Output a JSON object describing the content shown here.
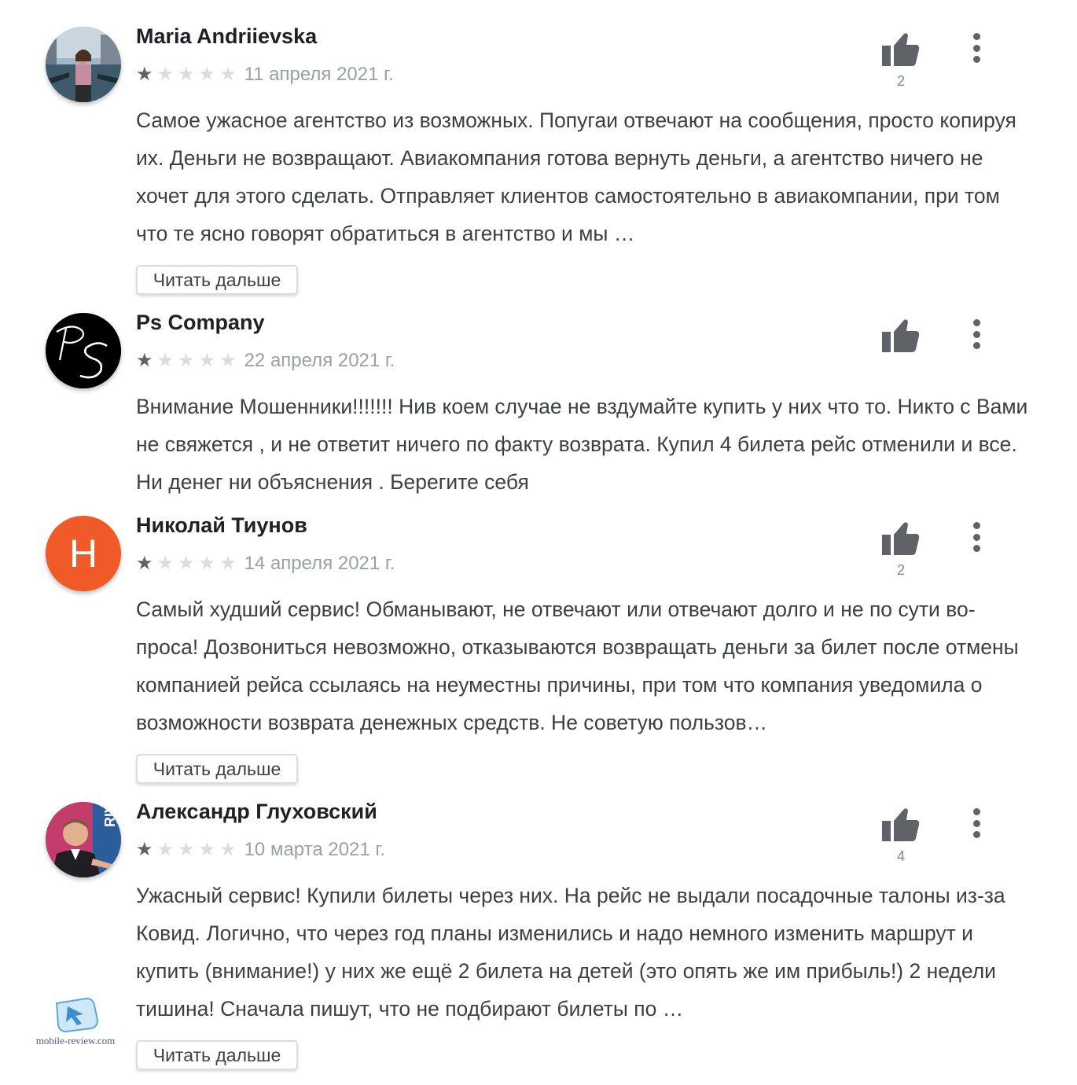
{
  "reviews": [
    {
      "name": "Maria Andriievska",
      "avatar_kind": "photo-venice",
      "rating": 1,
      "date": "11 апреля 2021 г.",
      "text": "Самое ужасное агентство из возможных. Попугаи отвечают на сообщения, просто ко­пируя их. Деньги не возвращают. Авиакомпания готова вернуть деньги, а агентство ничего не хочет для этого сделать. Отправляет клиентов самостоятельно в авиаком­пании, при том что те ясно говорят обратиться в агентство и мы …",
      "likes": "2",
      "read_more": "Читать дальше"
    },
    {
      "name": "Ps Company",
      "avatar_kind": "logo-ps",
      "avatar_letters": "PS",
      "rating": 1,
      "date": "22 апреля 2021 г.",
      "text": "Внимание Мошенники!!!!!!! Нив коем случае не вздумайте купить у них что то. Никто с Вами не свяжется , и не ответит ничего по факту возврата. Купил 4 билета рейс отме­нили и все. Ни денег ни объяснения . Берегите себя",
      "likes": "",
      "read_more": ""
    },
    {
      "name": "Николай Тиунов",
      "avatar_kind": "letter",
      "avatar_letter": "Н",
      "rating": 1,
      "date": "14 апреля 2021 г.",
      "text": "Самый худший сервис! Обманывают, не отвечают или отвечают долго и не по сути во­проса! Дозвониться невозможно, отказываются возвращать деньги за билет после отмены компанией рейса ссылаясь на неуместны причины, при том что компания уведомила о возможности возврата денежных средств. Не советую пользов…",
      "likes": "2",
      "read_more": "Читать дальше"
    },
    {
      "name": "Александр Глуховский",
      "avatar_kind": "photo-person",
      "avatar_caption": "RIVE",
      "rating": 1,
      "date": "10 марта 2021 г.",
      "text": "Ужасный сервис! Купили билеты через них. На рейс не выдали посадочные талоны из-за Ковид. Логично, что через год планы изменились и надо немного изменить маршрут и купить (внимание!) у них же ещё 2 билета на детей (это опять же им при­быль!) 2 недели тишина! Сначала пишут, что не подбирают билеты по …",
      "likes": "4",
      "read_more": "Читать дальше"
    }
  ],
  "watermark": {
    "text": "mobile-review.com"
  },
  "icons": {
    "like": "thumb-up-icon",
    "menu": "more-vert-icon",
    "star": "star-icon"
  },
  "colors": {
    "star_on": "#5f6368",
    "star_off": "#dadce0",
    "avatar_letter_bg": "#f05a28"
  }
}
